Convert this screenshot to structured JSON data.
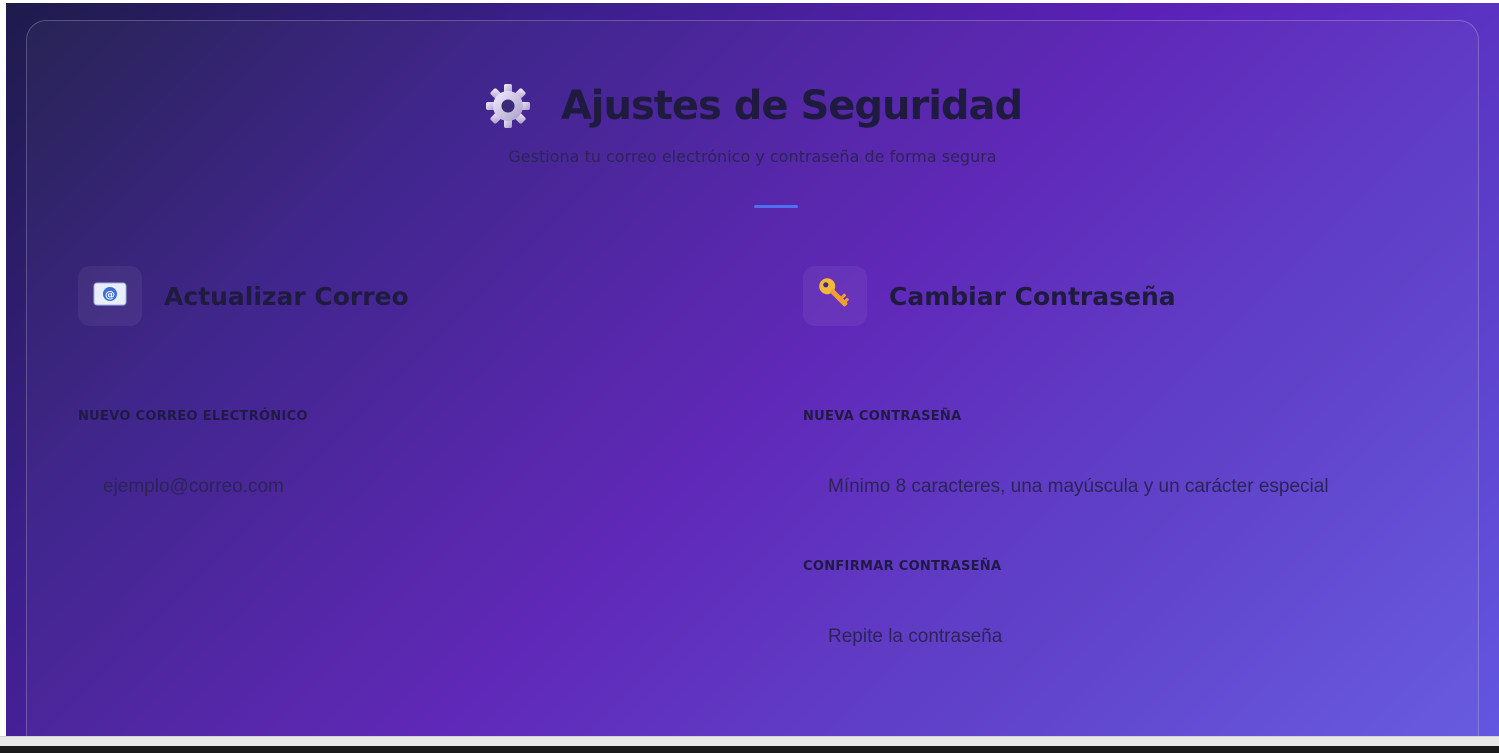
{
  "header": {
    "icon": "gear-icon",
    "title": "Ajustes de Seguridad",
    "subtitle": "Gestiona tu correo electrónico y contraseña de forma segura"
  },
  "email_section": {
    "icon": "email-icon",
    "title": "Actualizar Correo",
    "field_label": "NUEVO CORREO ELECTRÓNICO",
    "field_placeholder": "ejemplo@correo.com",
    "field_value": ""
  },
  "password_section": {
    "icon": "key-icon",
    "title": "Cambiar Contraseña",
    "new_label": "NUEVA CONTRASEÑA",
    "new_placeholder": "Mínimo 8 caracteres, una mayúscula y un carácter especial",
    "new_value": "",
    "confirm_label": "CONFIRMAR CONTRASEÑA",
    "confirm_placeholder": "Repite la contraseña",
    "confirm_value": ""
  },
  "colors": {
    "accent": "#4f6ef0",
    "heading": "#1e1b3f",
    "gradient_start": "#1e1b4b",
    "gradient_mid": "#5b21b6",
    "gradient_end": "#6356e0"
  }
}
